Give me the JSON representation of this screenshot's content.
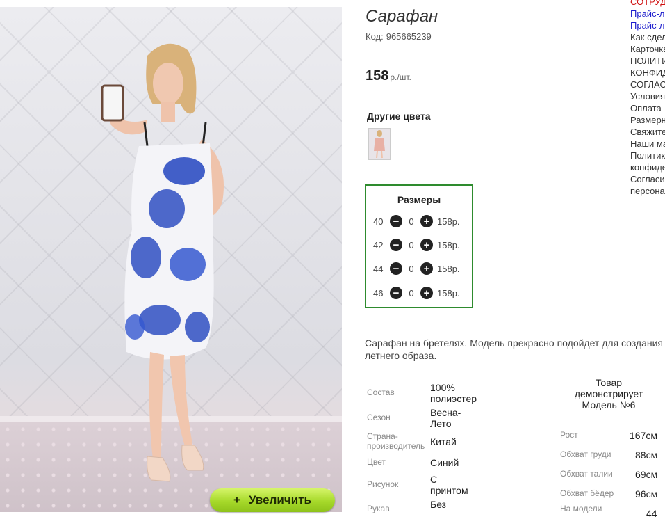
{
  "product": {
    "title": "Сарафан",
    "code_label": "Код:",
    "code_value": "965665239",
    "price": "158",
    "price_unit": "р./шт.",
    "other_colors_label": "Другие цвета",
    "enlarge_label": "Увеличить",
    "enlarge_icon": "+"
  },
  "sizes": {
    "title": "Размеры",
    "rows": [
      {
        "size": "40",
        "qty": "0",
        "price": "158р."
      },
      {
        "size": "42",
        "qty": "0",
        "price": "158р."
      },
      {
        "size": "44",
        "qty": "0",
        "price": "158р."
      },
      {
        "size": "46",
        "qty": "0",
        "price": "158р."
      }
    ]
  },
  "description": {
    "line1": "Сарафан на бретелях. Модель прекрасно подойдет для создания",
    "line2": "летнего образа."
  },
  "attributes": [
    {
      "label": "Состав",
      "value_lines": [
        "100%",
        "полиэстер"
      ]
    },
    {
      "label": "Сезон",
      "value_lines": [
        "Весна-",
        "Лето"
      ]
    },
    {
      "label_lines": [
        "Страна-",
        "производитель"
      ],
      "value_lines": [
        "Китай"
      ]
    },
    {
      "label": "Цвет",
      "value_lines": [
        "Синий"
      ]
    },
    {
      "label": "Рисунок",
      "value_lines": [
        "С",
        "принтом"
      ]
    },
    {
      "label": "Рукав",
      "value_lines": [
        "Без"
      ]
    }
  ],
  "model": {
    "heading_lines": [
      "Товар",
      "демонстрирует",
      "Модель №6"
    ],
    "measures": [
      {
        "label": "Рост",
        "value": "167см"
      },
      {
        "label": "Обхват груди",
        "value": "88см"
      },
      {
        "label": "Обхват талии",
        "value": "69см"
      },
      {
        "label": "Обхват бёдер",
        "value": "96см"
      },
      {
        "label": "На модели",
        "value": "44"
      }
    ]
  },
  "side_menu": [
    {
      "text": "СОТРУДНИЧЕСТВО",
      "style": "red"
    },
    {
      "text": "Прайс-лист",
      "style": "link"
    },
    {
      "text": "Прайс-лист",
      "style": "link"
    },
    {
      "text": "Как сделать заказ",
      "style": "plain"
    },
    {
      "text": "Карточка",
      "style": "plain"
    },
    {
      "text": "ПОЛИТИКА",
      "style": "plain"
    },
    {
      "text": "КОНФИДЕНЦИАЛЬНОСТИ",
      "style": "plain"
    },
    {
      "text": "СОГЛАСИЕ",
      "style": "plain"
    },
    {
      "text": "Условия",
      "style": "plain"
    },
    {
      "text": "Оплата",
      "style": "plain"
    },
    {
      "text": "Размерная сетка",
      "style": "plain"
    },
    {
      "text": "Свяжитесь с нами",
      "style": "plain"
    },
    {
      "text": "Наши магазины",
      "style": "plain"
    },
    {
      "text": "Политика",
      "style": "plain"
    },
    {
      "text": "конфиденциальности",
      "style": "plain"
    },
    {
      "text": "Согласие на обработку",
      "style": "plain"
    },
    {
      "text": "персональных данных",
      "style": "plain"
    }
  ],
  "colors": {
    "size_box_border": "#2e8b2e",
    "enlarge_button": "#a6d92a",
    "dress_blue": "#2f4fc2"
  }
}
